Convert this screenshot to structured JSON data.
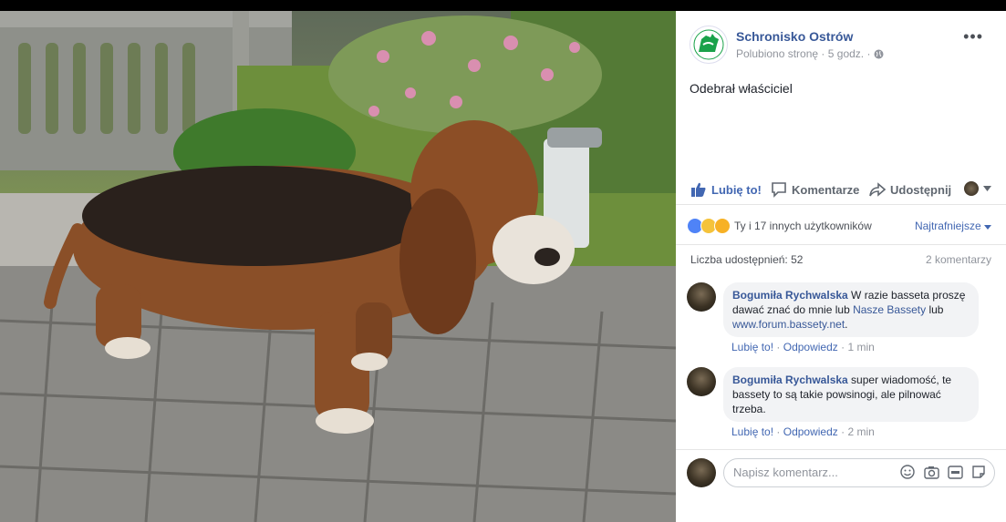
{
  "post": {
    "page_name": "Schronisko Ostrów",
    "liked_label": "Polubiono stronę",
    "separator": "·",
    "time": "5 godz.",
    "text": "Odebrał właściciel",
    "more": "•••"
  },
  "actions": {
    "like": "Lubię to!",
    "comment": "Komentarze",
    "share": "Udostępnij"
  },
  "reactions": {
    "text": "Ty i 17 innych użytkowników",
    "sort": "Najtrafniejsze",
    "shares": "Liczba udostępnień: 52",
    "comments_count": "2 komentarzy"
  },
  "comments": [
    {
      "author": "Bogumiła Rychwalska",
      "text_before": " W razie basseta proszę dawać znać do mnie lub ",
      "link1": "Nasze Bassety",
      "text_mid": " lub ",
      "link2": "www.forum.bassety.net",
      "text_after": ".",
      "like": "Lubię to!",
      "reply": "Odpowiedz",
      "time": "1 min"
    },
    {
      "author": "Bogumiła Rychwalska",
      "text": " super wiadomość, te bassety to są takie powsinogi, ale pilnować trzeba.",
      "like": "Lubię to!",
      "reply": "Odpowiedz",
      "time": "2 min"
    }
  ],
  "composer": {
    "placeholder": "Napisz komentarz..."
  },
  "colors": {
    "link": "#385898",
    "accent": "#4267b2",
    "brand": "#1aa24a"
  }
}
